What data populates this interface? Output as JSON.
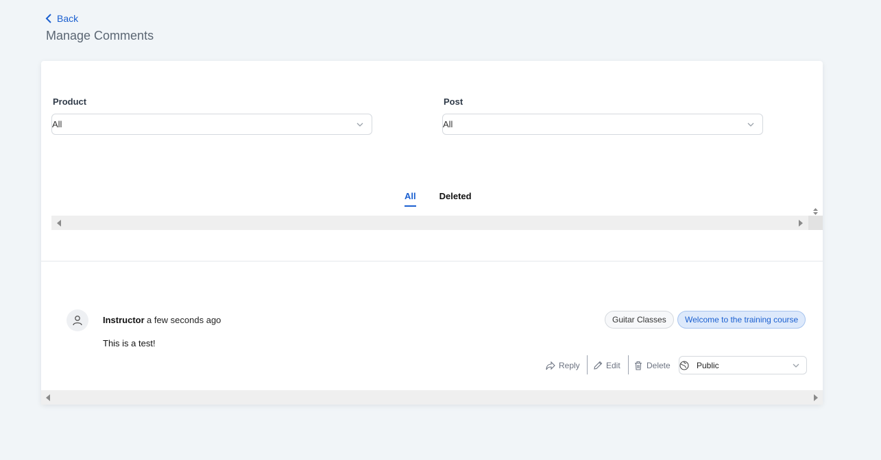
{
  "header": {
    "back_label": "Back",
    "title": "Manage Comments"
  },
  "filters": {
    "product": {
      "label": "Product",
      "value": "All"
    },
    "post": {
      "label": "Post",
      "value": "All"
    }
  },
  "tabs": [
    {
      "label": "All",
      "active": true
    },
    {
      "label": "Deleted",
      "active": false
    }
  ],
  "comment": {
    "author": "Instructor",
    "time": "a few seconds ago",
    "text": "This is a test!",
    "tags": [
      "Guitar Classes",
      "Welcome to the training course"
    ],
    "actions": {
      "reply": "Reply",
      "edit": "Edit",
      "delete": "Delete"
    },
    "visibility": "Public"
  },
  "colors": {
    "accent": "#1a5fd0",
    "background": "#f1f5f8",
    "tag_blue_bg": "#dde9fb"
  }
}
